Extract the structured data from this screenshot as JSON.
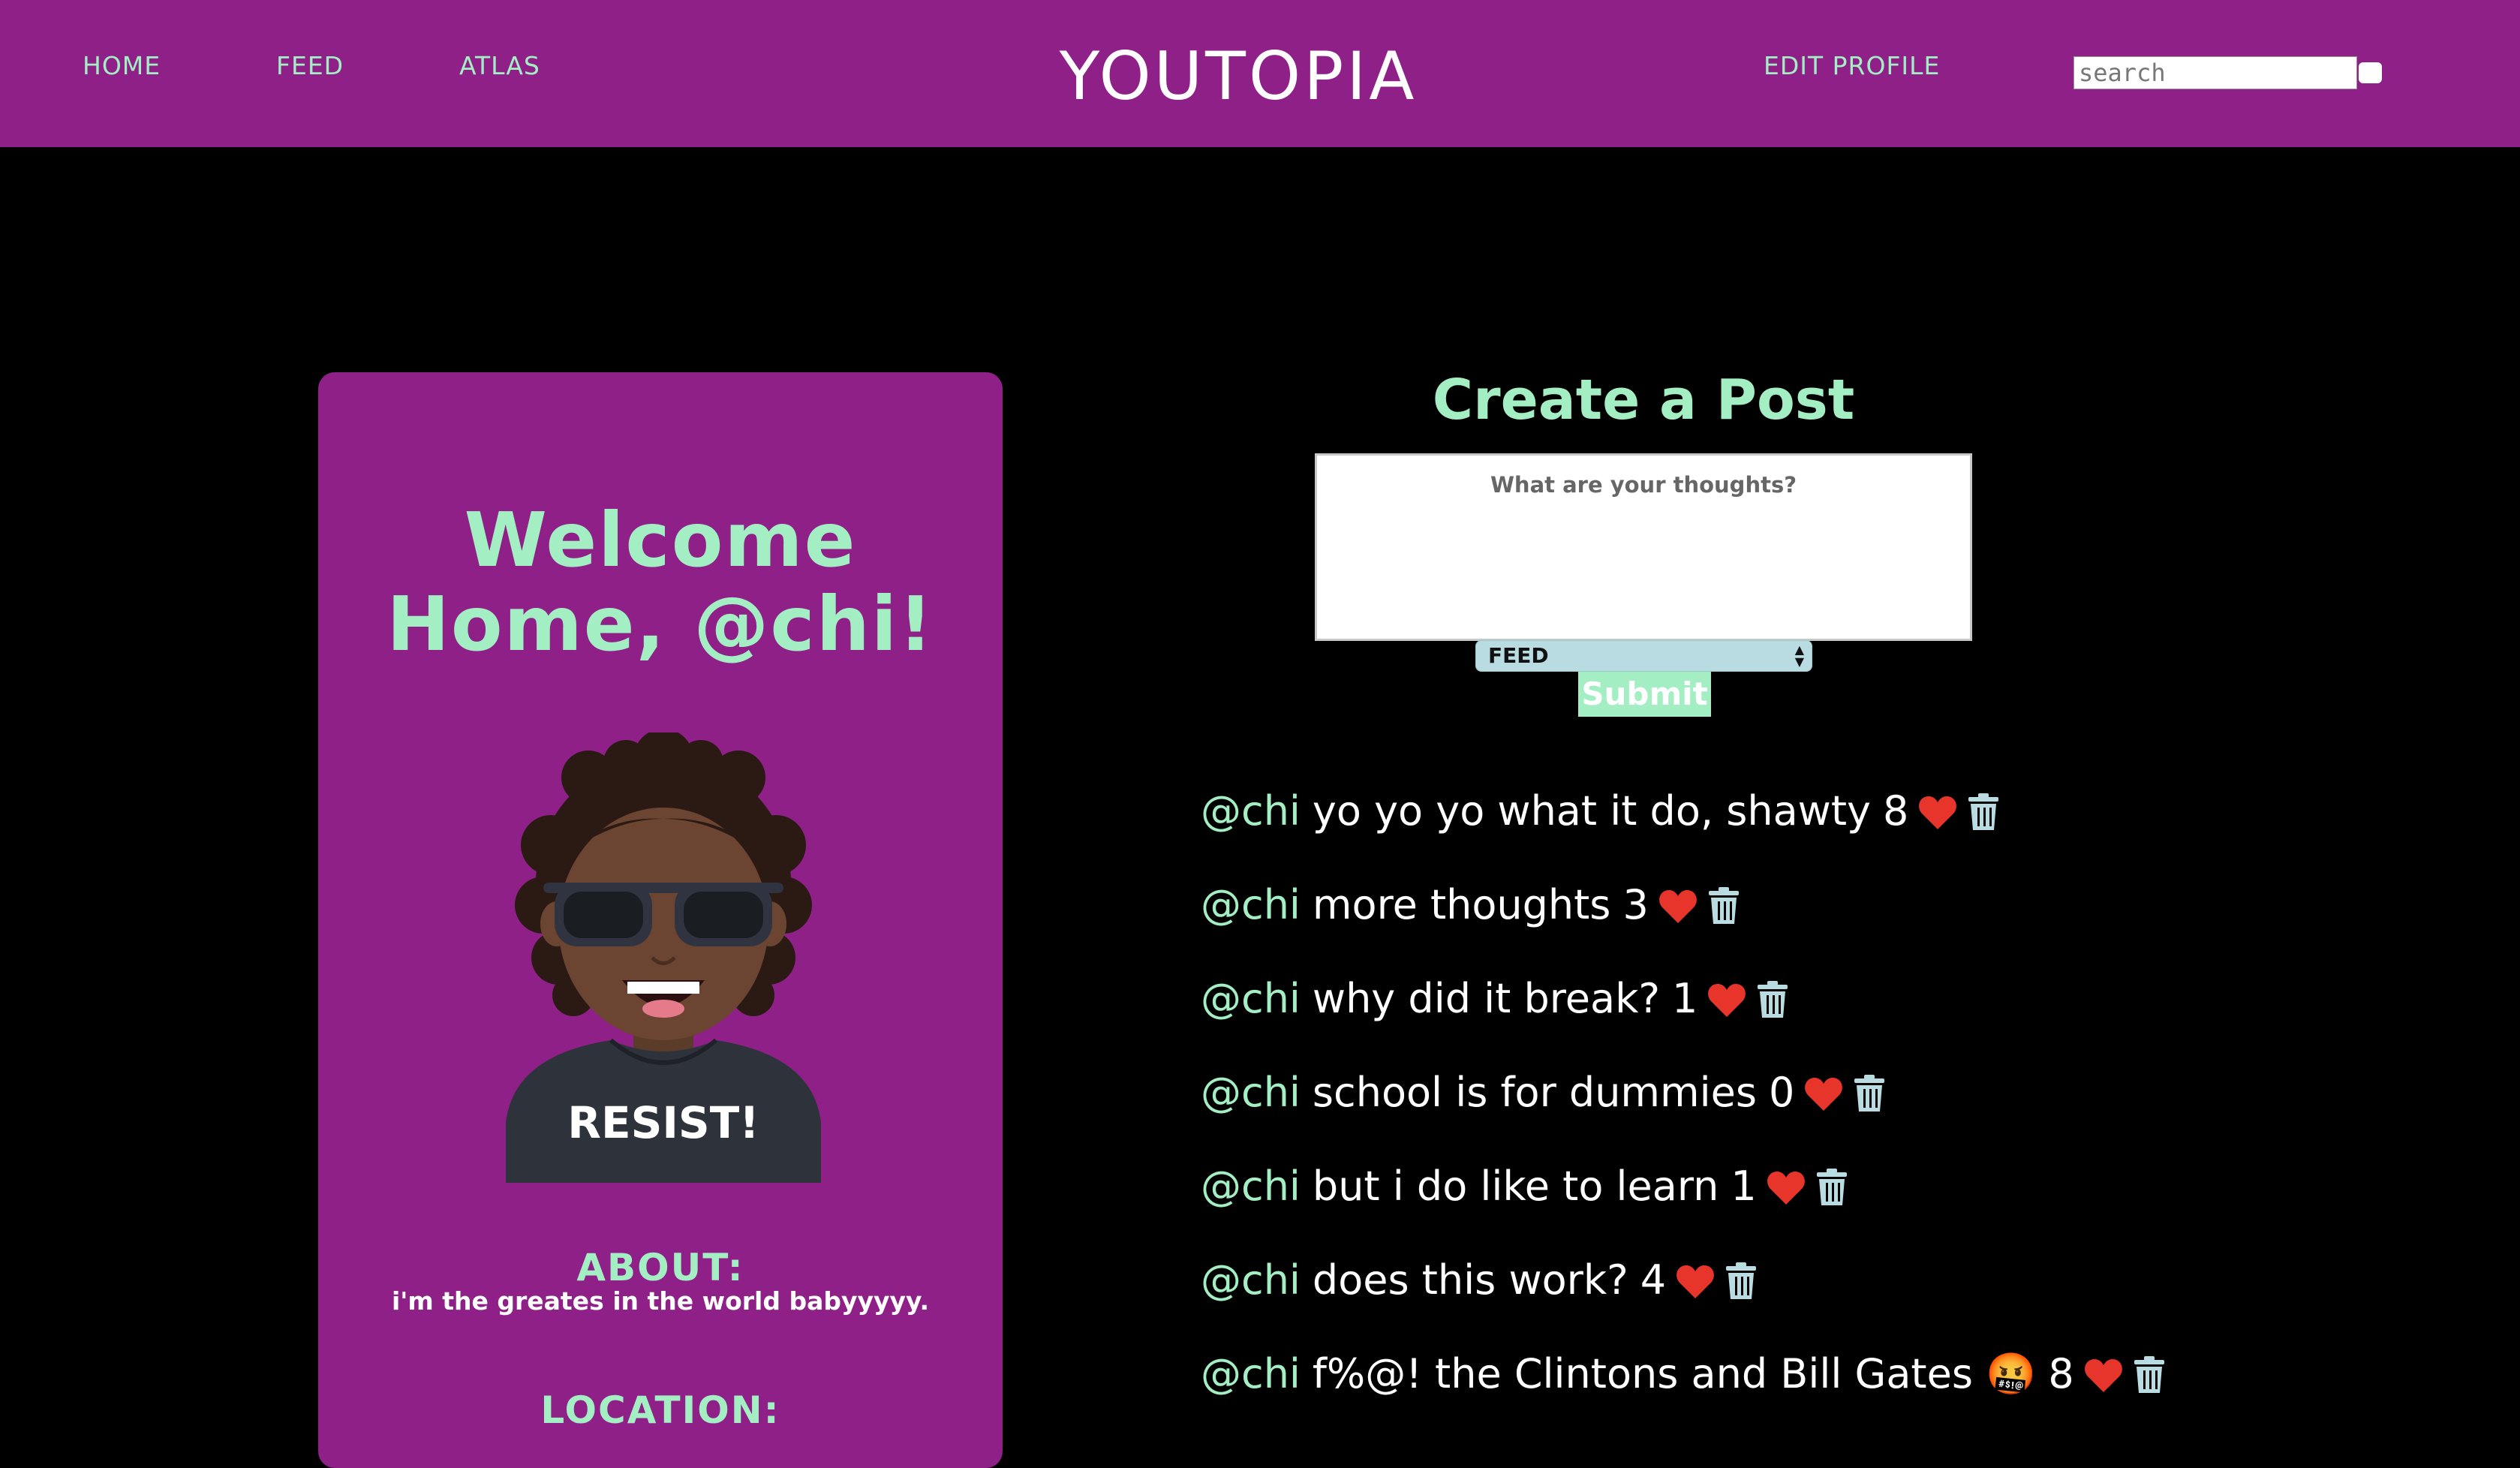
{
  "nav": {
    "home": "HOME",
    "feed": "FEED",
    "atlas": "ATLAS",
    "brand": "YOUTOPIA",
    "edit_profile": "EDIT PROFILE",
    "search_placeholder": "search"
  },
  "profile": {
    "welcome_line1": "Welcome",
    "welcome_line2": "Home, @chi!",
    "shirt_text": "RESIST!",
    "about_heading": "ABOUT:",
    "about_text": "i'm the greates in the world babyyyyy.",
    "location_heading": "LOCATION:"
  },
  "create_post": {
    "title": "Create a Post",
    "placeholder": "What are your thoughts?",
    "select_value": "FEED",
    "submit_label": "Submit"
  },
  "posts": [
    {
      "handle": "@chi",
      "text": "yo yo yo what it do, shawty",
      "likes": "8"
    },
    {
      "handle": "@chi",
      "text": "more thoughts",
      "likes": "3"
    },
    {
      "handle": "@chi",
      "text": "why did it break?",
      "likes": "1"
    },
    {
      "handle": "@chi",
      "text": "school is for dummies",
      "likes": "0"
    },
    {
      "handle": "@chi",
      "text": "but i do like to learn",
      "likes": "1"
    },
    {
      "handle": "@chi",
      "text": "does this work?",
      "likes": "4"
    },
    {
      "handle": "@chi",
      "text": "f%@! the Clintons and Bill Gates 🤬",
      "likes": "8"
    }
  ],
  "colors": {
    "header_bg": "#8e2088",
    "accent_mint": "#a4eec4",
    "page_bg": "#000000",
    "heart": "#e8352c",
    "trash": "#b8dce2"
  }
}
